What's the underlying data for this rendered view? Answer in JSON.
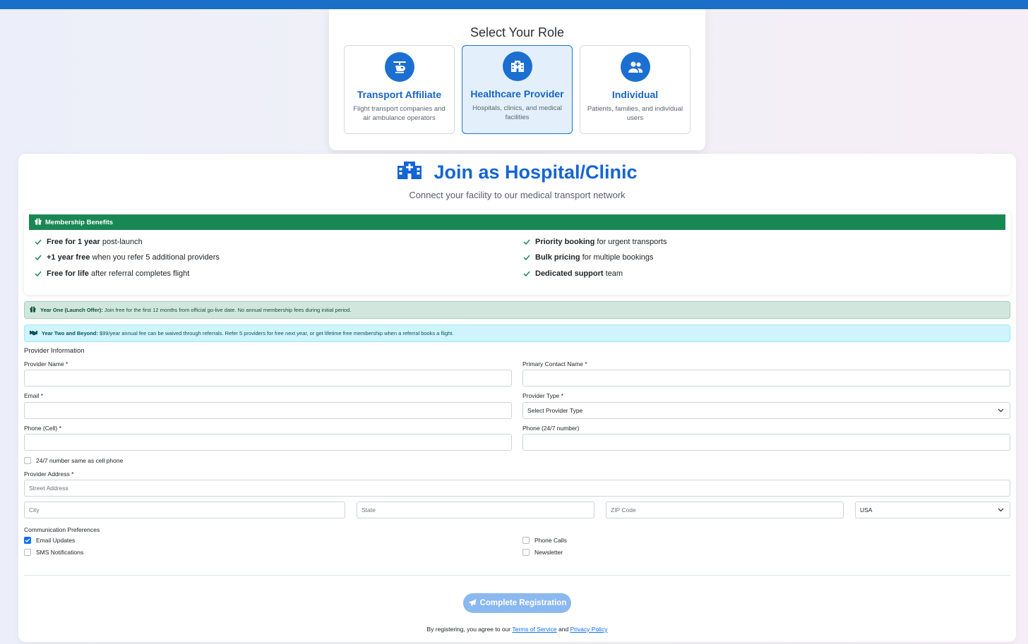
{
  "role_selector": {
    "title": "Select Your Role",
    "roles": [
      {
        "name": "Transport Affiliate",
        "desc": "Flight transport companies and air ambulance operators",
        "icon": "helicopter-icon",
        "selected": false
      },
      {
        "name": "Healthcare Provider",
        "desc": "Hospitals, clinics, and medical facilities",
        "icon": "hospital-icon",
        "selected": true
      },
      {
        "name": "Individual",
        "desc": "Patients, families, and individual users",
        "icon": "users-icon",
        "selected": false
      }
    ]
  },
  "header": {
    "title": "Join as Hospital/Clinic",
    "subtitle": "Connect your facility to our medical transport network"
  },
  "benefits": {
    "title": "Membership Benefits",
    "left": [
      {
        "bold": "Free for 1 year",
        "rest": " post-launch"
      },
      {
        "bold": "+1 year free",
        "rest": " when you refer 5 additional providers"
      },
      {
        "bold": "Free for life",
        "rest": " after referral completes flight"
      }
    ],
    "right": [
      {
        "bold": "Priority booking",
        "rest": " for urgent transports"
      },
      {
        "bold": "Bulk pricing",
        "rest": " for multiple bookings"
      },
      {
        "bold": "Dedicated support",
        "rest": " team"
      }
    ]
  },
  "alerts": {
    "year_one_label": "Year One (Launch Offer):",
    "year_one_text": " Join free for the first 12 months from official go-live date. No annual membership fees during initial period.",
    "year_two_label": "Year Two and Beyond:",
    "year_two_text": " $99/year annual fee can be waived through referrals. Refer 5 providers for free next year, or get lifetime free membership when a referral books a flight."
  },
  "form": {
    "section_title": "Provider Information",
    "provider_name_label": "Provider Name *",
    "primary_contact_label": "Primary Contact Name *",
    "email_label": "Email *",
    "provider_type_label": "Provider Type *",
    "provider_type_value": "Select Provider Type",
    "phone_cell_label": "Phone (Cell) *",
    "phone_247_label": "Phone (24/7 number)",
    "same_as_cell_label": "24/7 number same as cell phone",
    "address_label": "Provider Address *",
    "street_placeholder": "Street Address",
    "city_placeholder": "City",
    "state_placeholder": "State",
    "zip_placeholder": "ZIP Code",
    "country_value": "USA"
  },
  "preferences": {
    "title": "Communication Preferences",
    "email_updates": {
      "label": "Email Updates",
      "checked": true
    },
    "sms": {
      "label": "SMS Notifications",
      "checked": false
    },
    "phone_calls": {
      "label": "Phone Calls",
      "checked": false
    },
    "newsletter": {
      "label": "Newsletter",
      "checked": false
    }
  },
  "submit_label": "Complete Registration",
  "terms": {
    "prefix": "By registering, you agree to our ",
    "tos": "Terms of Service",
    "and": " and ",
    "privacy": "Privacy Policy"
  },
  "colors": {
    "primary": "#1b6fd0",
    "benefits_header": "#198754",
    "alert_green": "#d1e7dd",
    "alert_cyan": "#cff4fc",
    "submit_disabled": "#8bb8ef"
  }
}
